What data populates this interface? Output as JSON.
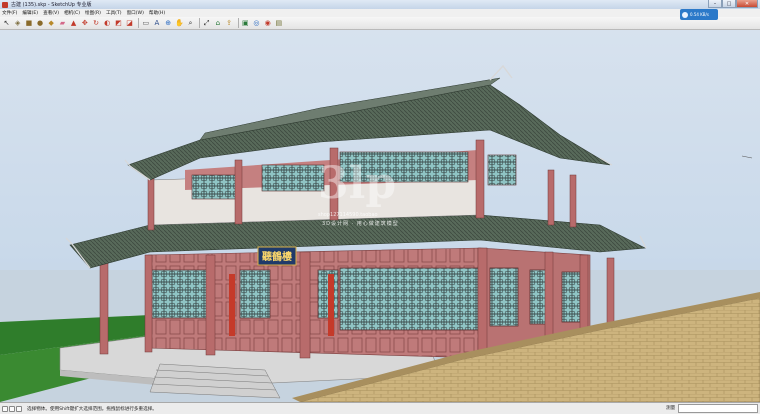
{
  "window": {
    "title": "古建 (135).skp - SketchUp 专业版",
    "minimize_glyph": "–",
    "maximize_glyph": "□",
    "close_glyph": "✕"
  },
  "menubar": {
    "items": [
      {
        "label": "文件(F)"
      },
      {
        "label": "编辑(E)"
      },
      {
        "label": "查看(V)"
      },
      {
        "label": "相机(C)"
      },
      {
        "label": "绘图(R)"
      },
      {
        "label": "工具(T)"
      },
      {
        "label": "窗口(W)"
      },
      {
        "label": "帮助(H)"
      }
    ]
  },
  "toolbar": {
    "tools": [
      {
        "name": "select-tool-icon",
        "glyph": "↖",
        "color": "#333333"
      },
      {
        "name": "make-component-icon",
        "glyph": "◈",
        "color": "#7a6a3a"
      },
      {
        "name": "rectangle-tool-icon",
        "glyph": "■",
        "color": "#8a6a2a"
      },
      {
        "name": "circle-tool-icon",
        "glyph": "●",
        "color": "#8a6a2a"
      },
      {
        "name": "paint-bucket-icon",
        "glyph": "◆",
        "color": "#b8892a"
      },
      {
        "name": "eraser-icon",
        "glyph": "▰",
        "color": "#d46a8a"
      },
      {
        "name": "push-pull-icon",
        "glyph": "▲",
        "color": "#c23a2a"
      },
      {
        "name": "move-tool-icon",
        "glyph": "✥",
        "color": "#c23a2a"
      },
      {
        "name": "rotate-tool-icon",
        "glyph": "↻",
        "color": "#c23a2a"
      },
      {
        "name": "follow-me-icon",
        "glyph": "◐",
        "color": "#c23a2a"
      },
      {
        "name": "scale-tool-icon",
        "glyph": "◩",
        "color": "#c23a2a"
      },
      {
        "name": "offset-tool-icon",
        "glyph": "◪",
        "color": "#c23a2a"
      },
      {
        "name": "tape-measure-icon",
        "glyph": "▭",
        "color": "#555555"
      },
      {
        "name": "text-tool-icon",
        "glyph": "A",
        "color": "#2a4a8a"
      },
      {
        "name": "orbit-tool-icon",
        "glyph": "⊕",
        "color": "#2a6ac2"
      },
      {
        "name": "pan-tool-icon",
        "glyph": "✋",
        "color": "#b87a3a"
      },
      {
        "name": "zoom-tool-icon",
        "glyph": "⌕",
        "color": "#333333"
      },
      {
        "name": "zoom-extents-icon",
        "glyph": "⤢",
        "color": "#333333"
      },
      {
        "name": "warehouse-icon",
        "glyph": "⌂",
        "color": "#2a7a3a"
      },
      {
        "name": "share-model-icon",
        "glyph": "⇪",
        "color": "#b8892a"
      },
      {
        "name": "get-models-icon",
        "glyph": "▣",
        "color": "#2a7a3a"
      },
      {
        "name": "extension-icon",
        "glyph": "◎",
        "color": "#2a6ac2"
      },
      {
        "name": "styles-icon",
        "glyph": "◉",
        "color": "#c23a2a"
      },
      {
        "name": "layers-icon",
        "glyph": "▤",
        "color": "#6a6a2a"
      }
    ]
  },
  "network_widget": {
    "speed": "0.54 KB/s"
  },
  "viewport": {
    "plaque_text": "聽鶴樓",
    "watermark_brand": "3lp",
    "watermark_url": "shop127114590.taobao",
    "watermark_tagline": "3D设计网 · 用心做建筑模型"
  },
  "statusbar": {
    "hint": "选择物体。使用Shift键扩大选择范围。拖拽鼠标进行多重选择。",
    "measure_label": "测量",
    "measure_value": ""
  },
  "colors": {
    "roof_tile": "#5a6b5c",
    "column_red": "#b86b6b",
    "lattice_cyan": "#7ab7b7",
    "wall_white": "#e8e4e0",
    "grass": "#2e7a2a",
    "wall_stone": "#c8b07a"
  }
}
